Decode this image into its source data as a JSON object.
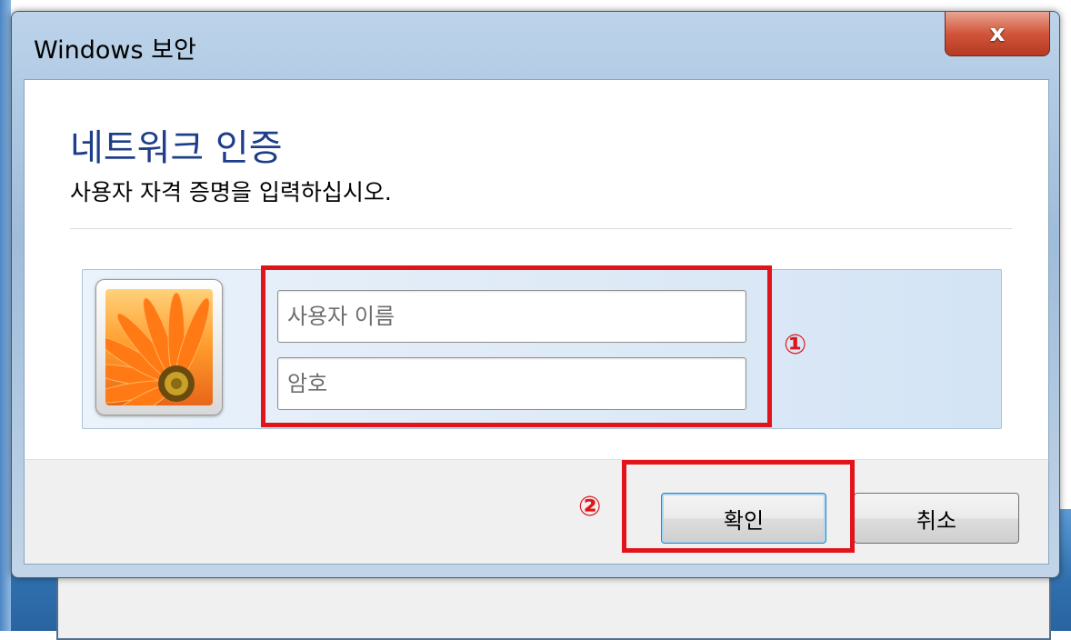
{
  "window": {
    "title": "Windows 보안",
    "close_label": "x"
  },
  "header": {
    "title": "네트워크 인증",
    "subtitle": "사용자 자격 증명을 입력하십시오."
  },
  "credentials": {
    "avatar_icon": "flower-user-tile-icon",
    "username": {
      "placeholder": "사용자 이름",
      "value": ""
    },
    "password": {
      "placeholder": "암호",
      "value": ""
    }
  },
  "footer": {
    "ok_label": "확인",
    "cancel_label": "취소"
  },
  "annotations": {
    "step1": "①",
    "step2": "②",
    "color": "#e0141a"
  },
  "colors": {
    "heading": "#1e3e8a",
    "close_button": "#d2553b"
  }
}
